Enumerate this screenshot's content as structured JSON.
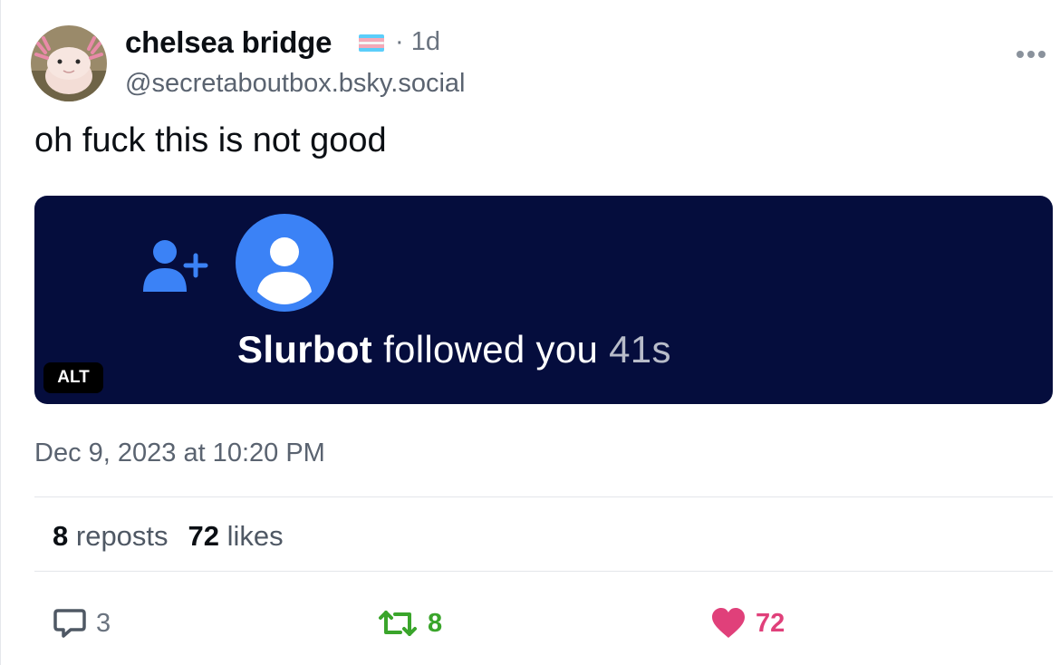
{
  "author": {
    "display_name": "chelsea bridge",
    "handle": "@secretaboutbox.bsky.social",
    "time_ago": "· 1d",
    "flag_icon": "trans-flag-icon"
  },
  "post": {
    "text": "oh fuck this is not good",
    "timestamp": "Dec 9, 2023 at 10:20 PM"
  },
  "media": {
    "notification_name": "Slurbot",
    "notification_action": " followed you ",
    "notification_time": "41s",
    "alt_label": "ALT",
    "background_color": "#050d3d",
    "icon_color": "#3b82f6"
  },
  "stats": {
    "reposts_count": "8",
    "reposts_label": "reposts",
    "likes_count": "72",
    "likes_label": "likes"
  },
  "actions": {
    "reply_count": "3",
    "repost_count": "8",
    "like_count": "72",
    "repost_color": "#3aa52b",
    "like_color": "#e0407a"
  }
}
